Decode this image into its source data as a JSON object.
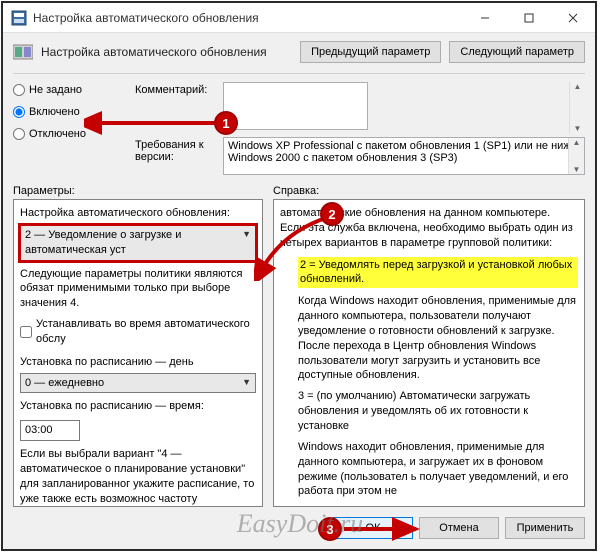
{
  "titlebar": {
    "title": "Настройка автоматического обновления"
  },
  "header": {
    "title": "Настройка автоматического обновления",
    "prev_btn": "Предыдущий параметр",
    "next_btn": "Следующий параметр"
  },
  "radios": {
    "not_set": "Не задано",
    "enabled": "Включено",
    "disabled": "Отключено"
  },
  "form": {
    "comment_label": "Комментарий:",
    "comment_value": "",
    "req_label": "Требования к версии:",
    "req_value": "Windows XP Professional с пакетом обновления 1 (SP1) или не ниже\nWindows 2000 с пакетом обновления 3 (SP3)"
  },
  "columns": {
    "left_head": "Параметры:",
    "right_head": "Справка:"
  },
  "left_panel": {
    "subhead": "Настройка автоматического обновления:",
    "mode_select": "2 — Уведомление о загрузке и автоматическая уст",
    "policy_note": "Следующие параметры политики являются обязат применимыми только при выборе значения 4.",
    "chk_label": "Устанавливать во время автоматического обслу",
    "sched_day_label": "Установка по расписанию — день",
    "sched_day_value": "0 — ежедневно",
    "sched_time_label": "Установка по расписанию — время:",
    "sched_time_value": "03:00",
    "tail": "Если вы выбрали вариант \"4 — автоматическое о планирование установки\" для запланированног укажите расписание, то уже также есть возможнос частоту обновлений (раз в неделю, в две неделе и другие варианты, отметив ниже"
  },
  "right_panel": {
    "p1": "автоматические обновления на данном компьютере. Если эта служба включена, необходимо выбрать один из четырех вариантов в параметре групповой политики:",
    "hl": "2 = Уведомлять перед загрузкой и установкой любых обновлений.",
    "p2": "Когда Windows находит обновления, применимые для данного компьютера, пользователи получают уведомление о готовности обновлений к загрузке. После перехода в Центр обновления Windows пользователи могут загрузить и установить все доступные обновления.",
    "p3": "3 = (по умолчанию) Автоматически загружать обновления и уведомлять об их готовности к установке",
    "p4": "Windows находит обновления, применимые для данного компьютера, и загружает их в фоновом режиме (пользовател ь получает уведомлений, и его работа при этом не"
  },
  "footer": {
    "ok": "ОК",
    "cancel": "Отмена",
    "apply": "Применить"
  },
  "annotations": {
    "a1": "1",
    "a2": "2",
    "a3": "3"
  },
  "watermark": "EasyDoit.ru"
}
